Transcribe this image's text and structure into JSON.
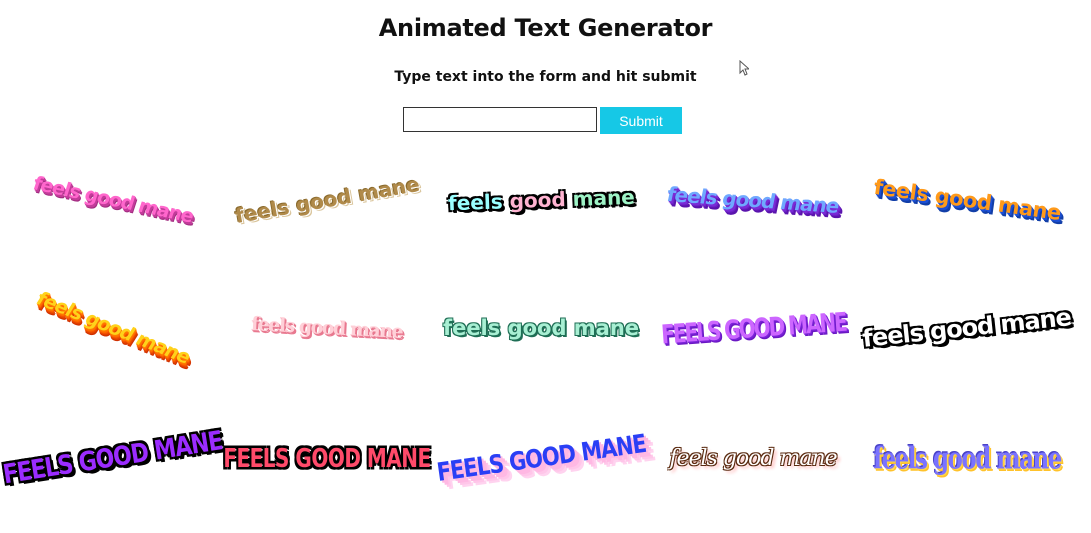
{
  "header": {
    "title": "Animated Text Generator",
    "subtitle": "Type text into the form and hit submit"
  },
  "form": {
    "input_value": "",
    "submit_label": "Submit"
  },
  "styles": [
    {
      "text": "feels good mane"
    },
    {
      "text": "feels good mane"
    },
    {
      "words": [
        "feels",
        "good",
        "mane"
      ]
    },
    {
      "text": "feels good mane"
    },
    {
      "text": "feels good mane"
    },
    {
      "text": "feels good mane"
    },
    {
      "text": "feels good mane"
    },
    {
      "text": "feels good mane"
    },
    {
      "text": "feels good mane"
    },
    {
      "text": "feels good mane"
    },
    {
      "text": "FEELS GOOD MANE"
    },
    {
      "text": "FEELS GOOD MANE"
    },
    {
      "text": "FEELS GOOD MANE"
    },
    {
      "text": "feels good mane"
    },
    {
      "text": "feels good mane"
    }
  ]
}
